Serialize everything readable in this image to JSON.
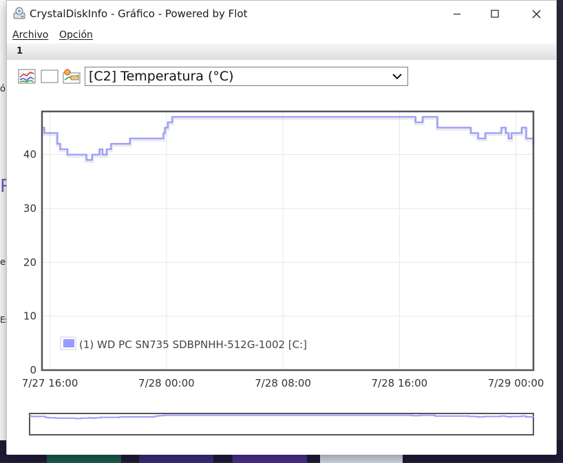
{
  "window": {
    "title": "CrystalDiskInfo - Gráfico - Powered by Flot",
    "menu": [
      "Archivo",
      "Opción"
    ],
    "tab": "1"
  },
  "toolbar": {
    "icons": [
      "multi-graph-icon",
      "blank-graph-icon",
      "settings-graph-icon"
    ],
    "select_value": "[C2] Temperatura (°C)"
  },
  "colors": {
    "series": "#9999ff",
    "border": "#545454",
    "grid": "#e6e6e6"
  },
  "background_text": [
    "ó",
    "R",
    "el",
    "Es"
  ],
  "chart_data": {
    "type": "line",
    "y_ticks": [
      0,
      10,
      20,
      30,
      40
    ],
    "ylim": [
      0,
      48
    ],
    "x_ticks": [
      "7/27 16:00",
      "7/28 00:00",
      "7/28 08:00",
      "7/28 16:00",
      "7/29 00:00"
    ],
    "x_tick_hours": [
      0,
      8,
      16,
      24,
      32
    ],
    "xlim_hours": [
      -0.55,
      33.2
    ],
    "grid": true,
    "legend": "bottom-left",
    "series": [
      {
        "name": "(1) WD PC SN735 SDBPNHH-512G-1002 [C:]",
        "x_hours": [
          -0.55,
          -0.4,
          0.5,
          0.7,
          1.2,
          2.0,
          2.5,
          2.9,
          3.4,
          3.6,
          3.9,
          4.2,
          4.5,
          5.5,
          7.5,
          7.8,
          7.9,
          8.1,
          8.4,
          21.6,
          23.6,
          24.8,
          25.1,
          25.6,
          26.6,
          27.0,
          27.9,
          28.4,
          28.9,
          29.4,
          29.9,
          31.0,
          31.3,
          31.5,
          31.7,
          32.4,
          32.7,
          33.2
        ],
        "values": [
          45,
          44,
          42,
          41,
          40,
          40,
          39,
          40,
          41,
          40,
          41,
          42,
          42,
          43,
          43,
          44,
          45,
          46,
          47,
          47,
          47,
          47,
          46,
          47,
          45,
          45,
          45,
          45,
          44,
          43,
          44,
          45,
          44,
          43,
          44,
          45,
          43,
          42
        ]
      }
    ]
  }
}
